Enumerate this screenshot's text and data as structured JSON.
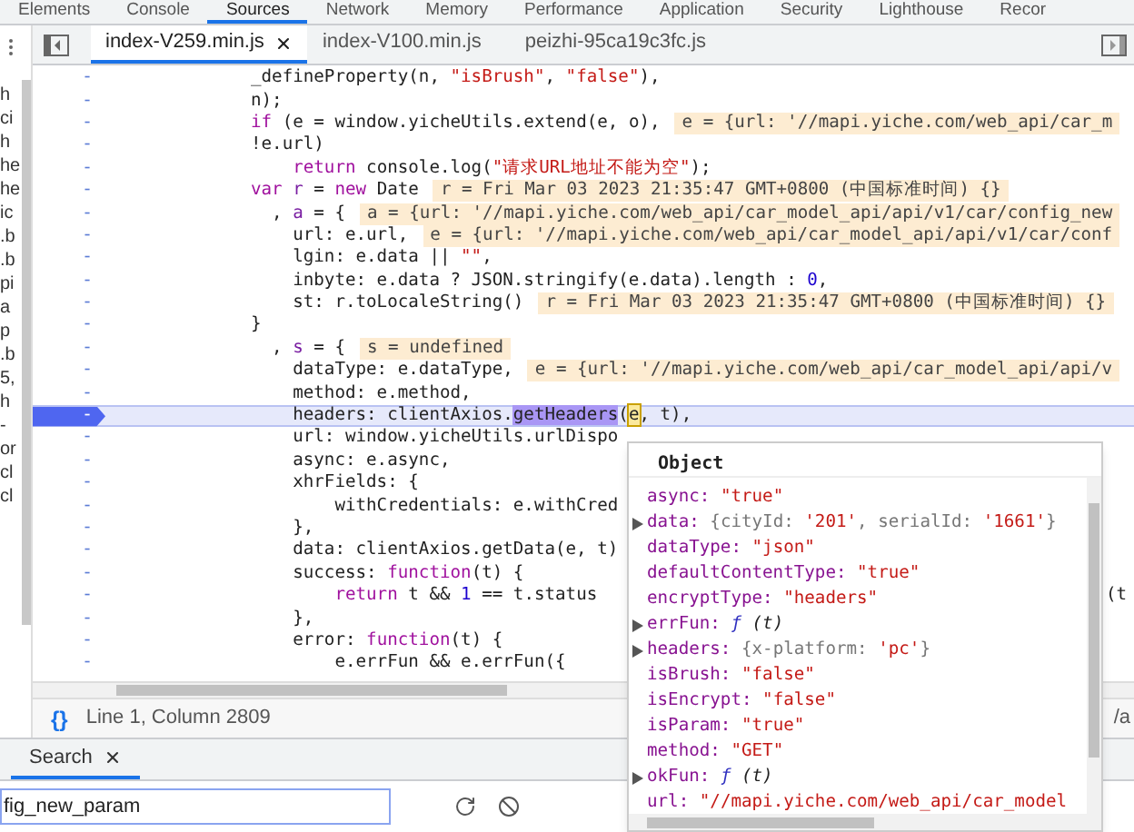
{
  "panel_tabs": [
    {
      "label": "Elements",
      "selected": false
    },
    {
      "label": "Console",
      "selected": false
    },
    {
      "label": "Sources",
      "selected": true
    },
    {
      "label": "Network",
      "selected": false
    },
    {
      "label": "Memory",
      "selected": false
    },
    {
      "label": "Performance",
      "selected": false
    },
    {
      "label": "Application",
      "selected": false
    },
    {
      "label": "Security",
      "selected": false
    },
    {
      "label": "Lighthouse",
      "selected": false
    },
    {
      "label": "Recor",
      "selected": false
    }
  ],
  "sidebar_fragments": [
    "h",
    "ci",
    "h",
    "he",
    "he",
    "ic",
    ".b",
    ".b",
    "pi",
    "a",
    "p",
    ".b",
    "5,",
    "h",
    "-",
    "or",
    "cl",
    "cl"
  ],
  "file_tabs": [
    {
      "label": "index-V259.min.js",
      "selected": true,
      "closable": true
    },
    {
      "label": "index-V100.min.js",
      "selected": false,
      "closable": false
    },
    {
      "label": "peizhi-95ca19c3fc.js",
      "selected": false,
      "closable": false
    }
  ],
  "code_lines": [
    {
      "marker": "-",
      "paused": false,
      "segments": [
        {
          "text": "_defineProperty(n, ",
          "kind": "plain"
        },
        {
          "text": "\"isBrush\"",
          "kind": "string"
        },
        {
          "text": ", ",
          "kind": "plain"
        },
        {
          "text": "\"false\"",
          "kind": "string"
        },
        {
          "text": "),",
          "kind": "plain"
        }
      ]
    },
    {
      "marker": "-",
      "paused": false,
      "segments": [
        {
          "text": "n);",
          "kind": "plain"
        }
      ]
    },
    {
      "marker": "-",
      "paused": false,
      "segments": [
        {
          "text": "if",
          "kind": "keyword"
        },
        {
          "text": " (e = window.yicheUtils.extend(e, o),",
          "kind": "plain"
        }
      ],
      "value": "e = {url: '//mapi.yiche.com/web_api/car_m"
    },
    {
      "marker": "-",
      "paused": false,
      "segments": [
        {
          "text": "!e.url)",
          "kind": "plain"
        }
      ]
    },
    {
      "marker": "-",
      "paused": false,
      "segments": [
        {
          "text": "    return",
          "kind": "keyword"
        },
        {
          "text": " console.log(",
          "kind": "plain"
        },
        {
          "text": "\"请求URL地址不能为空\"",
          "kind": "string"
        },
        {
          "text": ");",
          "kind": "plain"
        }
      ]
    },
    {
      "marker": "-",
      "paused": false,
      "segments": [
        {
          "text": "var ",
          "kind": "keyword"
        },
        {
          "text": "r",
          "kind": "def"
        },
        {
          "text": " = ",
          "kind": "plain"
        },
        {
          "text": "new",
          "kind": "keyword"
        },
        {
          "text": " Date",
          "kind": "plain"
        }
      ],
      "value": "r = Fri Mar 03 2023 21:35:47 GMT+0800 (中国标准时间) {}"
    },
    {
      "marker": "-",
      "paused": false,
      "segments": [
        {
          "text": "  , ",
          "kind": "plain"
        },
        {
          "text": "a",
          "kind": "def"
        },
        {
          "text": " = {",
          "kind": "plain"
        }
      ],
      "value": "a = {url: '//mapi.yiche.com/web_api/car_model_api/api/v1/car/config_new"
    },
    {
      "marker": "-",
      "paused": false,
      "segments": [
        {
          "text": "    url: e.url,",
          "kind": "plain"
        }
      ],
      "value": "e = {url: '//mapi.yiche.com/web_api/car_model_api/api/v1/car/conf"
    },
    {
      "marker": "-",
      "paused": false,
      "segments": [
        {
          "text": "    lgin: e.data || ",
          "kind": "plain"
        },
        {
          "text": "\"\"",
          "kind": "string"
        },
        {
          "text": ",",
          "kind": "plain"
        }
      ]
    },
    {
      "marker": "-",
      "paused": false,
      "segments": [
        {
          "text": "    inbyte: e.data ? JSON.stringify(e.data).length : ",
          "kind": "plain"
        },
        {
          "text": "0",
          "kind": "number"
        },
        {
          "text": ",",
          "kind": "plain"
        }
      ]
    },
    {
      "marker": "-",
      "paused": false,
      "segments": [
        {
          "text": "    st: r.toLocaleString()",
          "kind": "plain"
        }
      ],
      "value": "r = Fri Mar 03 2023 21:35:47 GMT+0800 (中国标准时间) {}"
    },
    {
      "marker": "-",
      "paused": false,
      "segments": [
        {
          "text": "}",
          "kind": "plain"
        }
      ]
    },
    {
      "marker": "-",
      "paused": false,
      "segments": [
        {
          "text": "  , ",
          "kind": "plain"
        },
        {
          "text": "s",
          "kind": "def"
        },
        {
          "text": " = {",
          "kind": "plain"
        }
      ],
      "value": "s = undefined"
    },
    {
      "marker": "-",
      "paused": false,
      "segments": [
        {
          "text": "    dataType: e.dataType,",
          "kind": "plain"
        }
      ],
      "value": "e = {url: '//mapi.yiche.com/web_api/car_model_api/api/v"
    },
    {
      "marker": "-",
      "paused": false,
      "segments": [
        {
          "text": "    method: e.method,",
          "kind": "plain"
        }
      ]
    },
    {
      "marker": "-",
      "paused": true,
      "segments": [
        {
          "text": "    headers: clientAxios.",
          "kind": "plain"
        },
        {
          "text": "getHeaders",
          "kind": "match"
        },
        {
          "text": "(",
          "kind": "plain"
        },
        {
          "text": "e",
          "kind": "cursor"
        },
        {
          "text": ", t),",
          "kind": "plain"
        }
      ]
    },
    {
      "marker": "-",
      "paused": false,
      "segments": [
        {
          "text": "    url: window.yicheUtils.urlDispo",
          "kind": "plain"
        }
      ]
    },
    {
      "marker": "-",
      "paused": false,
      "segments": [
        {
          "text": "    async: e.async,",
          "kind": "plain"
        }
      ]
    },
    {
      "marker": "-",
      "paused": false,
      "segments": [
        {
          "text": "    xhrFields: {",
          "kind": "plain"
        }
      ]
    },
    {
      "marker": "-",
      "paused": false,
      "segments": [
        {
          "text": "        withCredentials: e.withCred",
          "kind": "plain"
        }
      ]
    },
    {
      "marker": "-",
      "paused": false,
      "segments": [
        {
          "text": "    },",
          "kind": "plain"
        }
      ]
    },
    {
      "marker": "-",
      "paused": false,
      "segments": [
        {
          "text": "    data: clientAxios.getData(e, t)",
          "kind": "plain"
        }
      ]
    },
    {
      "marker": "-",
      "paused": false,
      "segments": [
        {
          "text": "    success: ",
          "kind": "plain"
        },
        {
          "text": "function",
          "kind": "keyword"
        },
        {
          "text": "(t) {",
          "kind": "plain"
        }
      ]
    },
    {
      "marker": "-",
      "paused": false,
      "segments": [
        {
          "text": "        return",
          "kind": "keyword"
        },
        {
          "text": " t && ",
          "kind": "plain"
        },
        {
          "text": "1",
          "kind": "number"
        },
        {
          "text": " == t.status",
          "kind": "plain"
        }
      ],
      "tail": "(t"
    },
    {
      "marker": "-",
      "paused": false,
      "segments": [
        {
          "text": "    },",
          "kind": "plain"
        }
      ]
    },
    {
      "marker": "-",
      "paused": false,
      "segments": [
        {
          "text": "    error: ",
          "kind": "plain"
        },
        {
          "text": "function",
          "kind": "keyword"
        },
        {
          "text": "(t) {",
          "kind": "plain"
        }
      ]
    },
    {
      "marker": "-",
      "paused": false,
      "segments": [
        {
          "text": "        e.errFun && e.errFun({",
          "kind": "plain"
        }
      ]
    }
  ],
  "popover": {
    "title": "Object",
    "entries": [
      {
        "key": "async:",
        "expandable": false,
        "value": [
          {
            "text": "\"true\"",
            "kind": "string"
          }
        ]
      },
      {
        "key": "data:",
        "expandable": true,
        "value": [
          {
            "text": "{cityId: ",
            "kind": "preview"
          },
          {
            "text": "'201'",
            "kind": "string"
          },
          {
            "text": ", serialId: ",
            "kind": "preview"
          },
          {
            "text": "'1661'",
            "kind": "string"
          },
          {
            "text": "}",
            "kind": "preview"
          }
        ]
      },
      {
        "key": "dataType:",
        "expandable": false,
        "value": [
          {
            "text": "\"json\"",
            "kind": "string"
          }
        ]
      },
      {
        "key": "defaultContentType:",
        "expandable": false,
        "value": [
          {
            "text": "\"true\"",
            "kind": "string"
          }
        ]
      },
      {
        "key": "encryptType:",
        "expandable": false,
        "value": [
          {
            "text": "\"headers\"",
            "kind": "string"
          }
        ]
      },
      {
        "key": "errFun:",
        "expandable": true,
        "value": [
          {
            "text": "ƒ",
            "kind": "function"
          },
          {
            "text": " (t)",
            "kind": "italic"
          }
        ]
      },
      {
        "key": "headers:",
        "expandable": true,
        "value": [
          {
            "text": "{x-platform: ",
            "kind": "preview"
          },
          {
            "text": "'pc'",
            "kind": "string"
          },
          {
            "text": "}",
            "kind": "preview"
          }
        ]
      },
      {
        "key": "isBrush:",
        "expandable": false,
        "value": [
          {
            "text": "\"false\"",
            "kind": "string"
          }
        ]
      },
      {
        "key": "isEncrypt:",
        "expandable": false,
        "value": [
          {
            "text": "\"false\"",
            "kind": "string"
          }
        ]
      },
      {
        "key": "isParam:",
        "expandable": false,
        "value": [
          {
            "text": "\"true\"",
            "kind": "string"
          }
        ]
      },
      {
        "key": "method:",
        "expandable": false,
        "value": [
          {
            "text": "\"GET\"",
            "kind": "string"
          }
        ]
      },
      {
        "key": "okFun:",
        "expandable": true,
        "value": [
          {
            "text": "ƒ",
            "kind": "function"
          },
          {
            "text": " (t)",
            "kind": "italic"
          }
        ]
      },
      {
        "key": "url:",
        "expandable": false,
        "value": [
          {
            "text": "\"//mapi.yiche.com/web_api/car_model",
            "kind": "string"
          }
        ]
      }
    ]
  },
  "status_bar": {
    "format_glyph": "{}",
    "position": "Line 1, Column 2809",
    "right_text": "/a"
  },
  "drawer": {
    "tabs": [
      {
        "label": "Search",
        "selected": true,
        "closable": true
      }
    ],
    "search_value": "fig_new_param"
  }
}
